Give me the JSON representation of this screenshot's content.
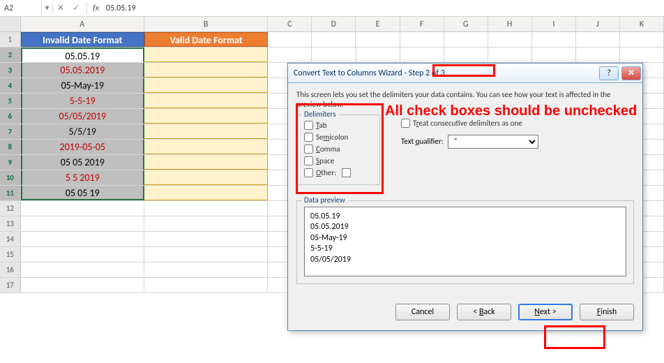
{
  "nameBox": "A2",
  "formula": "05.05.19",
  "columns": [
    "A",
    "B",
    "C",
    "D",
    "E",
    "F",
    "G",
    "H",
    "I",
    "J",
    "K"
  ],
  "headers": {
    "invalid": "Invalid Date Format",
    "valid": "Valid Date Format"
  },
  "rows": [
    {
      "n": 1
    },
    {
      "n": 2,
      "a": "05.05.19",
      "red": false
    },
    {
      "n": 3,
      "a": "05.05.2019",
      "red": true
    },
    {
      "n": 4,
      "a": "05-May-19",
      "red": false
    },
    {
      "n": 5,
      "a": "5-5-19",
      "red": true
    },
    {
      "n": 6,
      "a": "05/05/2019",
      "red": true
    },
    {
      "n": 7,
      "a": "5/5/19",
      "red": false
    },
    {
      "n": 8,
      "a": "2019-05-05",
      "red": true
    },
    {
      "n": 9,
      "a": "05 05 2019",
      "red": false
    },
    {
      "n": 10,
      "a": "5 5 2019",
      "red": true
    },
    {
      "n": 11,
      "a": "05 05 19",
      "red": false
    },
    {
      "n": 12
    },
    {
      "n": 13
    },
    {
      "n": 14
    },
    {
      "n": 15
    },
    {
      "n": 16
    },
    {
      "n": 17
    }
  ],
  "dialog": {
    "title": "Convert Text to Columns Wizard - Step 2 of 3",
    "desc": "This screen lets you set the delimiters your data contains.  You can see how your text is affected in the preview below.",
    "delimTitle": "Delimiters",
    "tab": "Tab",
    "semicolon": "Semicolon",
    "comma": "Comma",
    "space": "Space",
    "other": "Other:",
    "treat": "Treat consecutive delimiters as one",
    "qualifierLabel": "Text qualifier:",
    "qualifierValue": "\"",
    "previewTitle": "Data preview",
    "previewLines": [
      "05.05.19",
      "05.05.2019",
      "05-May-19",
      "5-5-19",
      "05/05/2019"
    ],
    "btnCancel": "Cancel",
    "btnBack": "< Back",
    "btnNext": "Next >",
    "btnFinish": "Finish",
    "help": "?",
    "close": "✕"
  },
  "annotation": "All check boxes should be unchecked"
}
